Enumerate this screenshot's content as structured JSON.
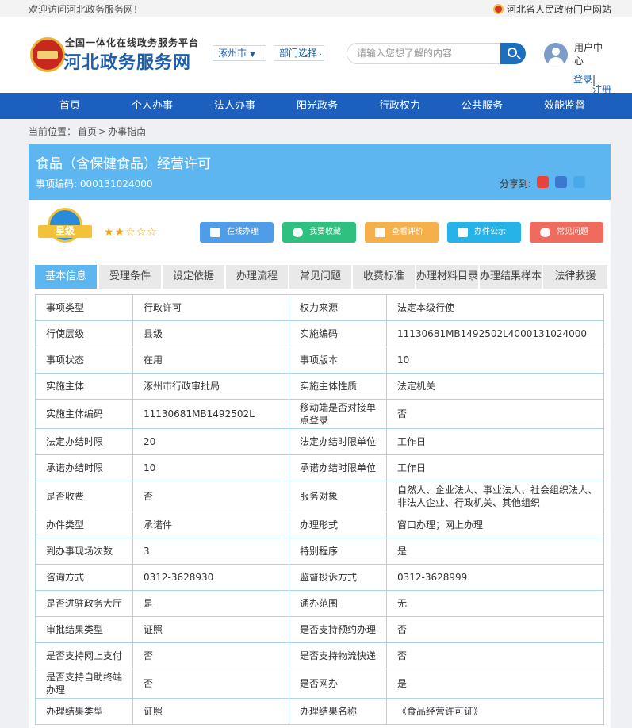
{
  "topbar": {
    "welcome": "欢迎访问河北政务服务网！",
    "portal": "河北省人民政府门户网站"
  },
  "header": {
    "logo_sub": "全国一体化在线政务服务平台",
    "logo_main": "河北政务服务网",
    "city": "涿州市",
    "dept": "部门选择",
    "search_placeholder": "请输入您想了解的内容",
    "user_center": "用户中心",
    "login": "登录",
    "register": "注册"
  },
  "nav": [
    "首页",
    "个人办事",
    "法人办事",
    "阳光政务",
    "行政权力",
    "公共服务",
    "效能监督"
  ],
  "breadcrumb": {
    "label": "当前位置：",
    "home": "首页",
    "sep": ">",
    "current": "办事指南"
  },
  "item": {
    "title": "食品（含保健食品）经营许可",
    "code_label": "事项编码:",
    "code": "000131024000",
    "share_label": "分享到:"
  },
  "rating": {
    "badge": "星级",
    "stars_on": "★★",
    "stars_off": "☆☆☆"
  },
  "actions": [
    {
      "label": "在线办理",
      "color": "#4f9de8"
    },
    {
      "label": "我要收藏",
      "color": "#2dc07e"
    },
    {
      "label": "查看评价",
      "color": "#f5b04c"
    },
    {
      "label": "办件公示",
      "color": "#26b3e8"
    },
    {
      "label": "常见问题",
      "color": "#f06a5e"
    }
  ],
  "tabs": [
    "基本信息",
    "受理条件",
    "设定依据",
    "办理流程",
    "常见问题",
    "收费标准",
    "办理材料目录",
    "办理结果样本",
    "法律救援"
  ],
  "rows": [
    [
      "事项类型",
      "行政许可",
      "权力来源",
      "法定本级行使"
    ],
    [
      "行使层级",
      "县级",
      "实施编码",
      "11130681MB1492502L4000131024000"
    ],
    [
      "事项状态",
      "在用",
      "事项版本",
      "10"
    ],
    [
      "实施主体",
      "涿州市行政审批局",
      "实施主体性质",
      "法定机关"
    ],
    [
      "实施主体编码",
      "11130681MB1492502L",
      "移动端是否对接单点登录",
      "否"
    ],
    [
      "法定办结时限",
      "20",
      "法定办结时限单位",
      "工作日"
    ],
    [
      "承诺办结时限",
      "10",
      "承诺办结时限单位",
      "工作日"
    ],
    [
      "是否收费",
      "否",
      "服务对象",
      "自然人、企业法人、事业法人、社会组织法人、非法人企业、行政机关、其他组织"
    ],
    [
      "办件类型",
      "承诺件",
      "办理形式",
      "窗口办理；网上办理"
    ],
    [
      "到办事现场次数",
      "3",
      "特别程序",
      "是"
    ],
    [
      "咨询方式",
      "0312-3628930",
      "监督投诉方式",
      "0312-3628999"
    ],
    [
      "是否进驻政务大厅",
      "是",
      "通办范围",
      "无"
    ],
    [
      "审批结果类型",
      "证照",
      "是否支持预约办理",
      "否"
    ],
    [
      "是否支持网上支付",
      "否",
      "是否支持物流快递",
      "否"
    ],
    [
      "是否支持自助终端办理",
      "否",
      "是否网办",
      "是"
    ],
    [
      "办理结果类型",
      "证照",
      "办理结果名称",
      "《食品经营许可证》"
    ]
  ]
}
